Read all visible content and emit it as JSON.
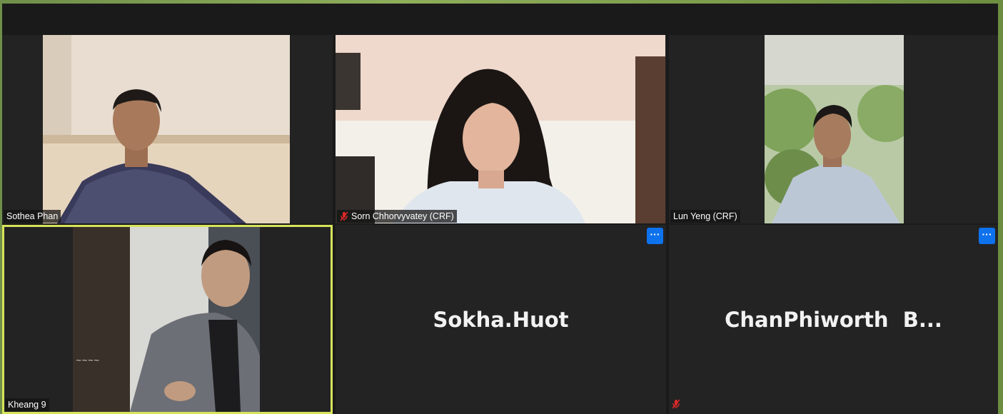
{
  "participants": [
    {
      "name": "Sothea Phan",
      "muted": false,
      "video": true
    },
    {
      "name": "Sorn Chhorvyvatey (CRF)",
      "muted": true,
      "video": true
    },
    {
      "name": "Lun Yeng (CRF)",
      "muted": false,
      "video": true
    },
    {
      "name": "Kheang 9",
      "muted": false,
      "video": true,
      "active_speaker": true
    },
    {
      "name": "Sokha.Huot",
      "muted": false,
      "video": false
    },
    {
      "name": "ChanPhiworth  B...",
      "muted": true,
      "video": false
    }
  ],
  "colors": {
    "active_border": "#d7e35a",
    "more_button": "#0e72ed",
    "muted_icon": "#e02828"
  },
  "icons": {
    "more": "more-options-icon",
    "muted": "mic-muted-icon"
  },
  "more_glyph": "···"
}
